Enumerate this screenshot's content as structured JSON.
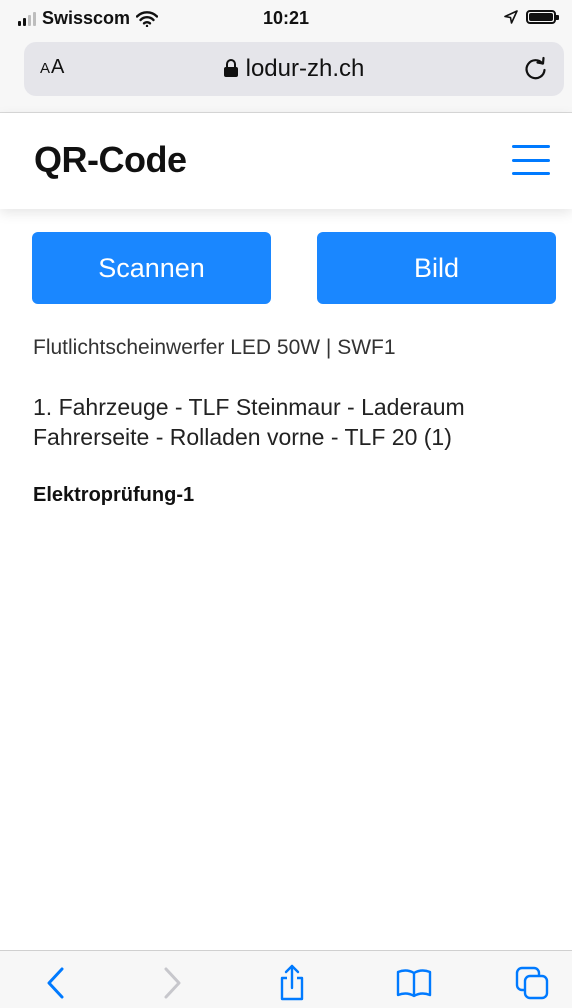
{
  "status_bar": {
    "carrier": "Swisscom",
    "time": "10:21"
  },
  "browser": {
    "text_size_label_small": "A",
    "text_size_label_large": "A",
    "url": "lodur-zh.ch"
  },
  "header": {
    "title": "QR-Code"
  },
  "actions": {
    "scan_label": "Scannen",
    "image_label": "Bild"
  },
  "item": {
    "name": "Flutlichtscheinwerfer LED 50W | SWF1",
    "location": "1. Fahrzeuge - TLF Steinmaur - Laderaum Fahrerseite - Rolladen vorne - TLF 20 (1)",
    "check": "Elektroprüfung-1"
  },
  "colors": {
    "accent": "#007aff",
    "button": "#1a87ff"
  },
  "icons": [
    "signal-icon",
    "wifi-icon",
    "location-icon",
    "battery-icon",
    "lock-icon",
    "reload-icon",
    "menu-icon",
    "back-icon",
    "forward-icon",
    "share-icon",
    "bookmarks-icon",
    "tabs-icon"
  ]
}
